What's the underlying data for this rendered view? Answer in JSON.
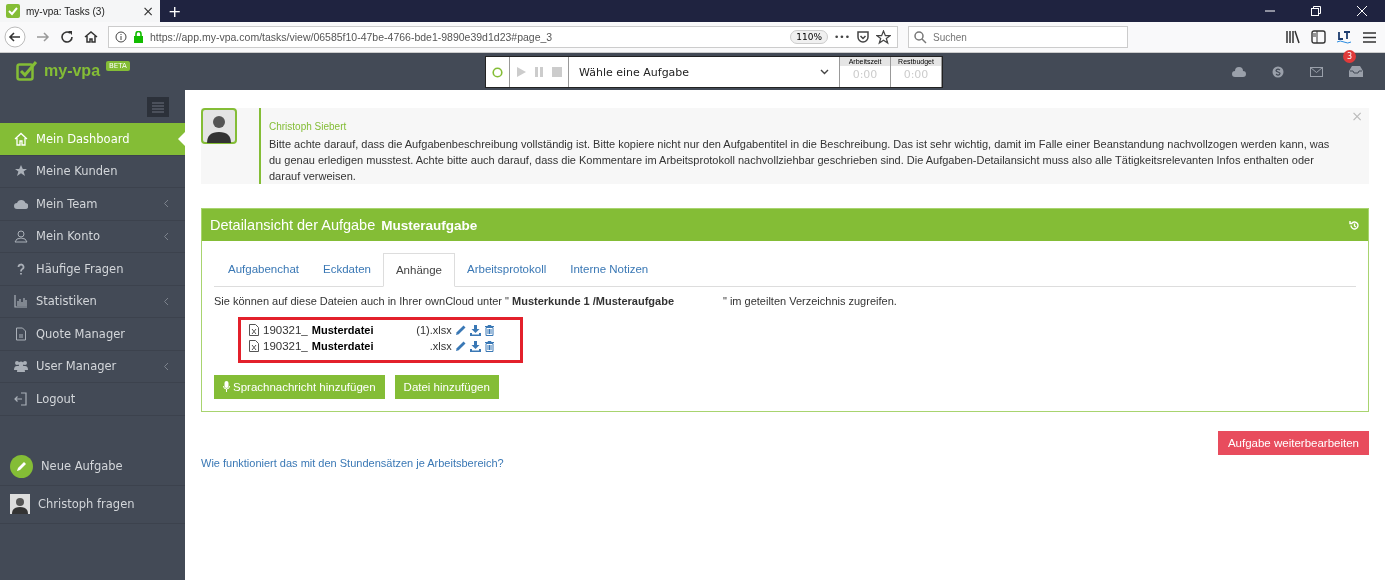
{
  "browser": {
    "tab_title": "my-vpa: Tasks (3)",
    "tab_close": "×",
    "new_tab": "+",
    "url": "https://app.my-vpa.com/tasks/view/06585f10-47be-4766-bde1-9890e39d1d23#page_3",
    "zoom": "110%",
    "more": "•••",
    "search": {
      "placeholder": "Suchen"
    }
  },
  "header": {
    "logo": "my-vpa",
    "beta": "BETA",
    "task_select": {
      "value": "Wähle eine Aufgabe"
    },
    "timers": [
      {
        "label": "Arbeitszeit",
        "value": "0:00"
      },
      {
        "label": "Restbudget",
        "value": "0:00"
      }
    ],
    "notification_count": "3"
  },
  "sidebar": {
    "items": [
      {
        "label": "Mein Dashboard",
        "selected": true,
        "expandable": false
      },
      {
        "label": "Meine Kunden",
        "selected": false,
        "expandable": false
      },
      {
        "label": "Mein Team",
        "selected": false,
        "expandable": true
      },
      {
        "label": "Mein Konto",
        "selected": false,
        "expandable": true
      },
      {
        "label": "Häufige Fragen",
        "selected": false,
        "expandable": false
      },
      {
        "label": "Statistiken",
        "selected": false,
        "expandable": true
      },
      {
        "label": "Quote Manager",
        "selected": false,
        "expandable": false
      },
      {
        "label": "User Manager",
        "selected": false,
        "expandable": true
      },
      {
        "label": "Logout",
        "selected": false,
        "expandable": false
      }
    ],
    "new_task": "Neue Aufgabe",
    "ask": "Christoph fragen"
  },
  "notice": {
    "author": "Christoph Siebert",
    "text": "Bitte achte darauf, dass die Aufgabenbeschreibung vollständig ist. Bitte kopiere nicht nur den Aufgabentitel in die Beschreibung. Das ist sehr wichtig, damit im Falle einer Beanstandung nachvollzogen werden kann, was du genau erledigen musstest. Achte bitte auch darauf, dass die Kommentare im Arbeitsprotokoll nachvollziehbar geschrieben sind. Die Aufgaben-Detailansicht muss also alle Tätigkeitsrelevanten Infos enthalten oder darauf verweisen.",
    "close": "×"
  },
  "panel": {
    "title": "Detailansicht der Aufgabe",
    "task_name": "Musteraufgabe",
    "tabs": [
      {
        "label": "Aufgabenchat",
        "selected": false
      },
      {
        "label": "Eckdaten",
        "selected": false
      },
      {
        "label": "Anhänge",
        "selected": true
      },
      {
        "label": "Arbeitsprotokoll",
        "selected": false
      },
      {
        "label": "Interne Notizen",
        "selected": false
      }
    ],
    "info": "Sie können auf diese Dateien auch in Ihrer ownCloud unter \" **Musterkunde 1 /Musteraufgabe**                \" im geteilten Verzeichnis zugreifen.",
    "files": [
      {
        "prefix": "190321_",
        "name": "Musterdatei",
        "suffix": "(1).xlsx"
      },
      {
        "prefix": "190321_",
        "name": "Musterdatei",
        "suffix": ".xlsx"
      }
    ],
    "buttons": [
      "Sprachnachricht hinzufügen",
      "Datei hinzufügen"
    ]
  },
  "continue_button": "Aufgabe weiterbearbeiten",
  "help_link": "Wie funktioniert das mit den Stundensätzen je Arbeitsbereich?"
}
